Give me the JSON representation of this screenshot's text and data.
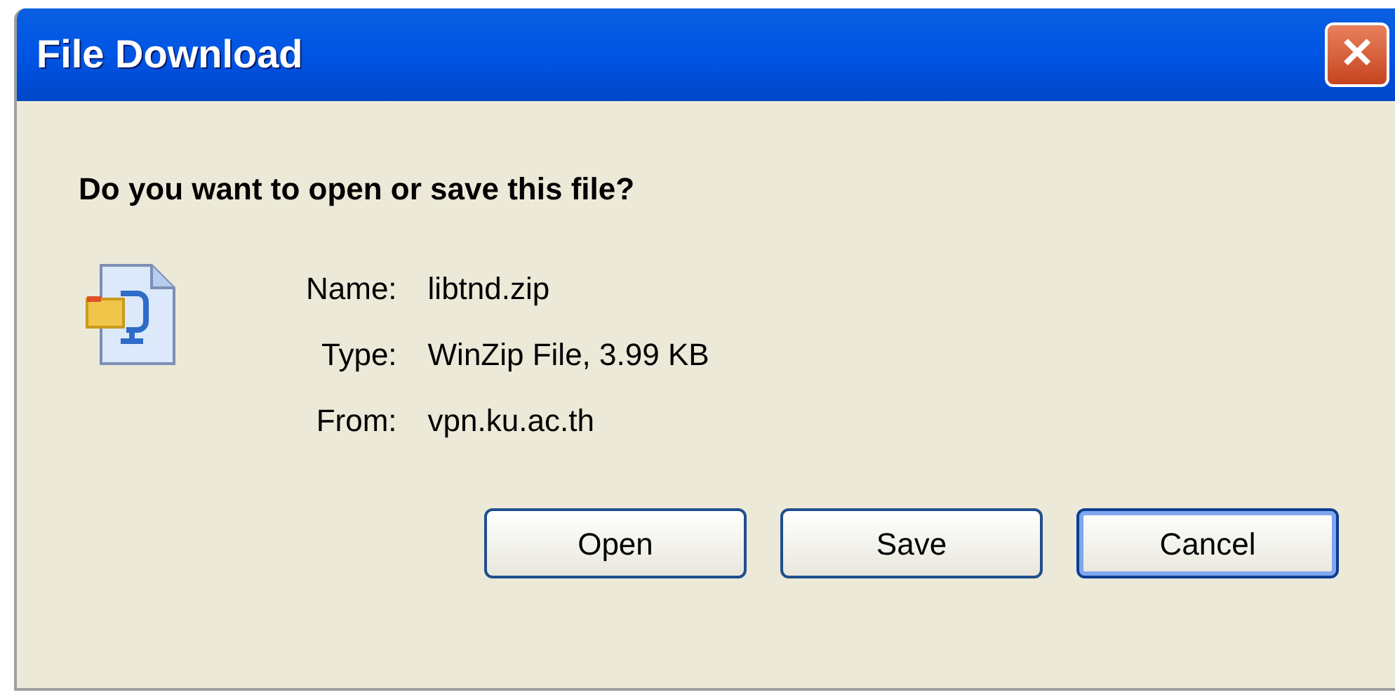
{
  "window": {
    "title": "File Download",
    "close_glyph": "✕"
  },
  "question": "Do you want to open or save this file?",
  "details": [
    {
      "label": "Name:",
      "value": "libtnd.zip"
    },
    {
      "label": "Type:",
      "value": "WinZip File, 3.99 KB"
    },
    {
      "label": "From:",
      "value": "vpn.ku.ac.th"
    }
  ],
  "buttons": [
    {
      "label": "Open",
      "default": false
    },
    {
      "label": "Save",
      "default": false
    },
    {
      "label": "Cancel",
      "default": true
    }
  ]
}
